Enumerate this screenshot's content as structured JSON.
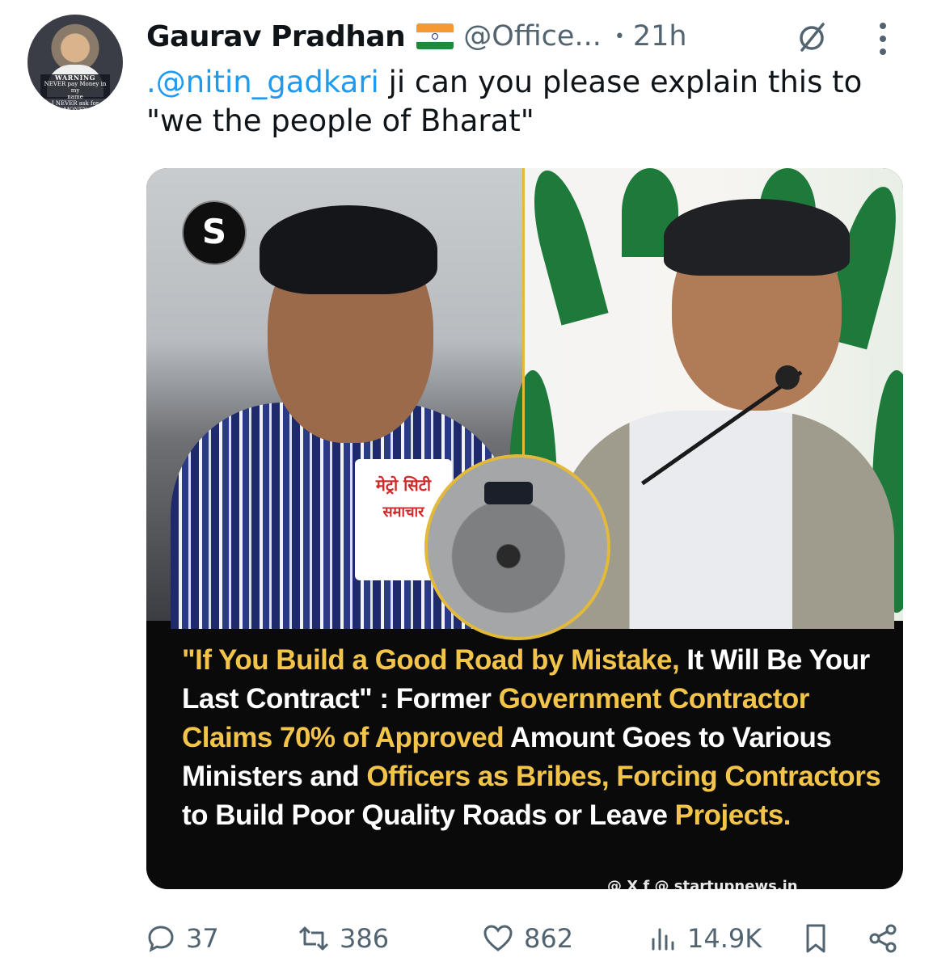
{
  "author": {
    "name": "Gaurav Pradhan",
    "flag": "indian-flag-emoji",
    "handle": "@Office...",
    "separator": "•",
    "time": "21h",
    "avatar_caption": {
      "title": "WARNING",
      "line1": "NEVER pay Money in my",
      "line2": "name",
      "line3": "I NEVER ask for MONEY"
    }
  },
  "tweet": {
    "mention": ".@nitin_gadkari",
    "text_rest": " ji can you please explain this to \"we the people of Bharat\""
  },
  "media": {
    "mic_text_top": "मेट्रो सिटी",
    "mic_text_bottom": "समाचार",
    "logo_glyph": "S",
    "headline": {
      "p1": "\"If You Build a Good Road by Mistake, ",
      "p2": "It Will Be Your Last Contract\" : Former ",
      "p3": "Government Contractor Claims 70% of Approved",
      "p4": " Amount Goes to Various Ministers and ",
      "p5": "Officers as Bribes, Forcing Contractors",
      "p6": " to Build Poor Quality Roads or Leave ",
      "p7": "Projects."
    },
    "credit": "@ X f @ startupnews.in"
  },
  "actions": {
    "replies": "37",
    "retweets": "386",
    "likes": "862",
    "views": "14.9K"
  },
  "colors": {
    "accent": "#1d9bf0",
    "muted": "#536471",
    "highlight": "#f2c54a"
  }
}
